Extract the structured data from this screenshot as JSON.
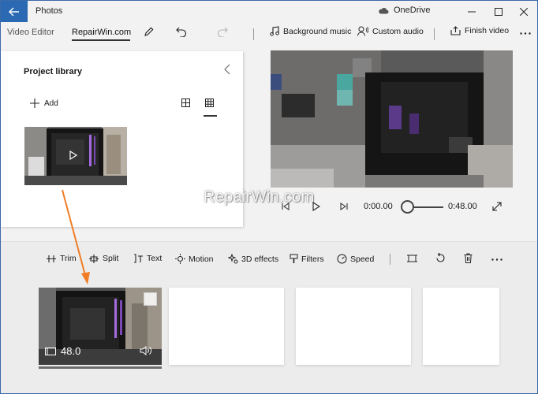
{
  "titlebar": {
    "app_name": "Photos",
    "cloud_label": "OneDrive"
  },
  "toolbar": {
    "breadcrumb_parent": "Video Editor",
    "project_name": "RepairWin.com",
    "background_music": "Background music",
    "custom_audio": "Custom audio",
    "finish_video": "Finish video"
  },
  "library": {
    "title": "Project library",
    "add_label": "Add"
  },
  "player": {
    "current_time": "0:00.00",
    "total_time": "0:48.00",
    "progress": 0
  },
  "watermark": "RepairWin.com",
  "storyboard": {
    "tools": {
      "trim": "Trim",
      "split": "Split",
      "text": "Text",
      "motion": "Motion",
      "effects_3d": "3D effects",
      "filters": "Filters",
      "speed": "Speed"
    },
    "cards": [
      {
        "duration": "48.0"
      }
    ]
  },
  "colors": {
    "accent": "#2b6ab3",
    "annotation_arrow": "#f07d26"
  }
}
